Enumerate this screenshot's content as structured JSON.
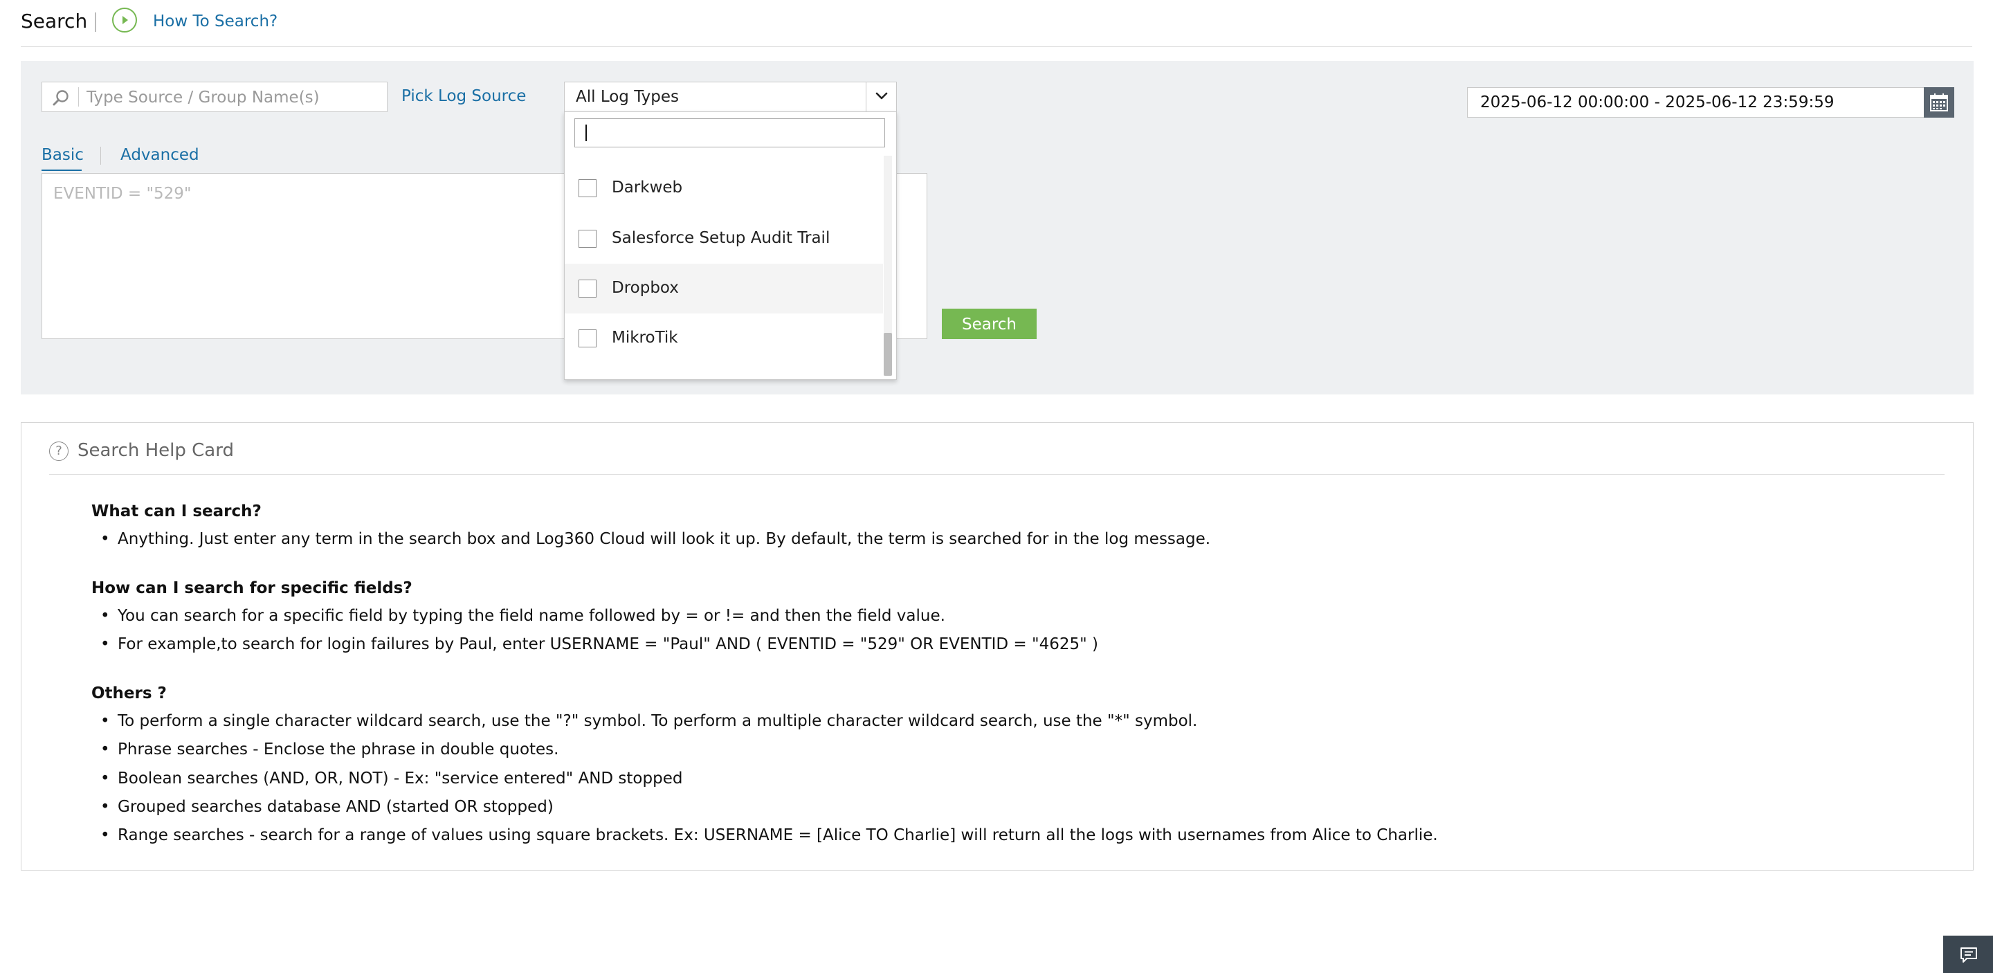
{
  "header": {
    "title": "Search",
    "how_to_link": "How To Search?"
  },
  "search_panel": {
    "source_placeholder": "Type Source / Group Name(s)",
    "pick_log_source": "Pick Log Source",
    "log_type_selected": "All Log Types",
    "date_range": "2025-06-12 00:00:00 - 2025-06-12 23:59:59",
    "tabs": [
      {
        "label": "Basic",
        "active": true
      },
      {
        "label": "Advanced",
        "active": false
      }
    ],
    "query_placeholder": "EVENTID = \"529\"",
    "search_button": "Search"
  },
  "log_type_dropdown": {
    "filter_value": "",
    "items": [
      {
        "label": "Darkweb",
        "checked": false
      },
      {
        "label": "Salesforce Setup Audit Trail",
        "checked": false
      },
      {
        "label": "Dropbox",
        "checked": false,
        "hovered": true
      },
      {
        "label": "MikroTik",
        "checked": false
      }
    ]
  },
  "help_card": {
    "title": "Search Help Card",
    "sections": [
      {
        "heading": "What can I search?",
        "bullets": [
          "Anything. Just enter any term in the search box and Log360 Cloud will look it up. By default, the term is searched for in the log message."
        ]
      },
      {
        "heading": "How can I search for specific fields?",
        "bullets": [
          "You can search for a specific field by typing the field name followed by = or != and then the field value.",
          "For example,to search for login failures by Paul, enter USERNAME = \"Paul\" AND ( EVENTID = \"529\" OR EVENTID = \"4625\" )"
        ]
      },
      {
        "heading": "Others ?",
        "bullets": [
          "To perform a single character wildcard search, use the \"?\" symbol. To perform a multiple character wildcard search, use the \"*\" symbol.",
          "Phrase searches - Enclose the phrase in double quotes.",
          "Boolean searches (AND, OR, NOT) - Ex: \"service entered\" AND stopped",
          "Grouped searches database AND (started OR stopped)",
          "Range searches - search for a range of values using square brackets. Ex: USERNAME = [Alice TO Charlie] will return all the logs with usernames from Alice to Charlie."
        ]
      }
    ]
  },
  "colors": {
    "link": "#1a6fa5",
    "accent_green": "#76b852",
    "panel_bg": "#eef0f2",
    "calendar_bg": "#5a6570",
    "chat_bg": "#3b4650"
  },
  "icons": {
    "how_to": "play-circle-icon",
    "source_search": "magnifier-icon",
    "dropdown_caret": "chevron-down-icon",
    "calendar": "calendar-icon",
    "help": "question-circle-icon",
    "chat": "chat-icon"
  }
}
